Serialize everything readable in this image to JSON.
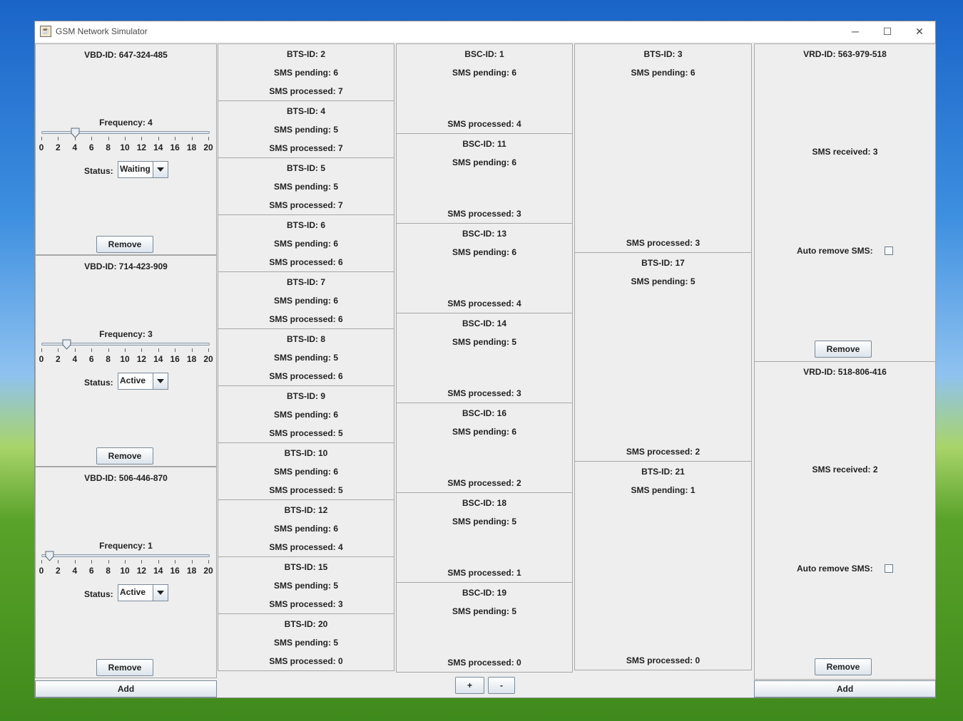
{
  "window": {
    "title": "GSM Network Simulator",
    "controls": {
      "minimize": "─",
      "maximize": "☐",
      "close": "✕"
    }
  },
  "vbd": {
    "add_label": "Add",
    "ticks": [
      "0",
      "2",
      "4",
      "6",
      "8",
      "10",
      "12",
      "14",
      "16",
      "18",
      "20"
    ],
    "freq_min": 0,
    "freq_max": 20,
    "items": [
      {
        "id": "VBD-ID: 647-324-485",
        "frequency_label": "Frequency: 4",
        "frequency": 4,
        "status_label": "Status:",
        "status": "Waiting",
        "remove": "Remove"
      },
      {
        "id": "VBD-ID: 714-423-909",
        "frequency_label": "Frequency: 3",
        "frequency": 3,
        "status_label": "Status:",
        "status": "Active",
        "remove": "Remove"
      },
      {
        "id": "VBD-ID: 506-446-870",
        "frequency_label": "Frequency: 1",
        "frequency": 1,
        "status_label": "Status:",
        "status": "Active",
        "remove": "Remove"
      }
    ]
  },
  "bts_col1": [
    {
      "id": "BTS-ID: 2",
      "pending": "SMS pending: 6",
      "processed": "SMS processed: 7"
    },
    {
      "id": "BTS-ID: 4",
      "pending": "SMS pending: 5",
      "processed": "SMS processed: 7"
    },
    {
      "id": "BTS-ID: 5",
      "pending": "SMS pending: 5",
      "processed": "SMS processed: 7"
    },
    {
      "id": "BTS-ID: 6",
      "pending": "SMS pending: 6",
      "processed": "SMS processed: 6"
    },
    {
      "id": "BTS-ID: 7",
      "pending": "SMS pending: 6",
      "processed": "SMS processed: 6"
    },
    {
      "id": "BTS-ID: 8",
      "pending": "SMS pending: 5",
      "processed": "SMS processed: 6"
    },
    {
      "id": "BTS-ID: 9",
      "pending": "SMS pending: 6",
      "processed": "SMS processed: 5"
    },
    {
      "id": "BTS-ID: 10",
      "pending": "SMS pending: 6",
      "processed": "SMS processed: 5"
    },
    {
      "id": "BTS-ID: 12",
      "pending": "SMS pending: 6",
      "processed": "SMS processed: 4"
    },
    {
      "id": "BTS-ID: 15",
      "pending": "SMS pending: 5",
      "processed": "SMS processed: 3"
    },
    {
      "id": "BTS-ID: 20",
      "pending": "SMS pending: 5",
      "processed": "SMS processed: 0"
    }
  ],
  "bsc": [
    {
      "id": "BSC-ID: 1",
      "pending": "SMS pending: 6",
      "processed": "SMS processed: 4"
    },
    {
      "id": "BSC-ID: 11",
      "pending": "SMS pending: 6",
      "processed": "SMS processed: 3"
    },
    {
      "id": "BSC-ID: 13",
      "pending": "SMS pending: 6",
      "processed": "SMS processed: 4"
    },
    {
      "id": "BSC-ID: 14",
      "pending": "SMS pending: 5",
      "processed": "SMS processed: 3"
    },
    {
      "id": "BSC-ID: 16",
      "pending": "SMS pending: 6",
      "processed": "SMS processed: 2"
    },
    {
      "id": "BSC-ID: 18",
      "pending": "SMS pending: 5",
      "processed": "SMS processed: 1"
    },
    {
      "id": "BSC-ID: 19",
      "pending": "SMS pending: 5",
      "processed": "SMS processed: 0"
    }
  ],
  "bsc_controls": {
    "plus": "+",
    "minus": "-"
  },
  "bts_col2": [
    {
      "id": "BTS-ID: 3",
      "pending": "SMS pending: 6",
      "processed": "SMS processed: 3"
    },
    {
      "id": "BTS-ID: 17",
      "pending": "SMS pending: 5",
      "processed": "SMS processed: 2"
    },
    {
      "id": "BTS-ID: 21",
      "pending": "SMS pending: 1",
      "processed": "SMS processed: 0"
    }
  ],
  "vrd": {
    "add_label": "Add",
    "items": [
      {
        "id": "VRD-ID: 563-979-518",
        "received": "SMS received: 3",
        "auto_remove_label": "Auto remove SMS:",
        "auto_remove": false,
        "remove": "Remove"
      },
      {
        "id": "VRD-ID: 518-806-416",
        "received": "SMS received: 2",
        "auto_remove_label": "Auto remove SMS:",
        "auto_remove": false,
        "remove": "Remove"
      }
    ]
  }
}
